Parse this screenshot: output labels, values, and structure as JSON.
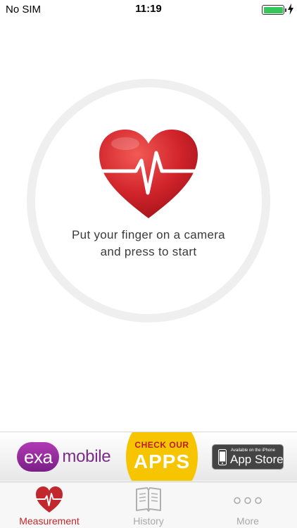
{
  "status_bar": {
    "carrier": "No SIM",
    "time": "11:19",
    "battery_level": 1.0
  },
  "measure": {
    "instruction_line1": "Put your finger on a camera",
    "instruction_line2": "and press to start"
  },
  "ad": {
    "brand_left": "exa",
    "brand_right": "mobile",
    "cta_line1": "CHECK OUR",
    "cta_line2": "APPS",
    "store_small": "Available on the iPhone",
    "store_big": "App Store"
  },
  "tabs": [
    {
      "label": "Measurement",
      "icon": "heart-pulse-icon",
      "active": true
    },
    {
      "label": "History",
      "icon": "book-icon",
      "active": false
    },
    {
      "label": "More",
      "icon": "more-dots-icon",
      "active": false
    }
  ],
  "colors": {
    "accent": "#c1272d",
    "inactive": "#a9a9a9",
    "ring": "#efefef",
    "battery": "#35c759"
  }
}
